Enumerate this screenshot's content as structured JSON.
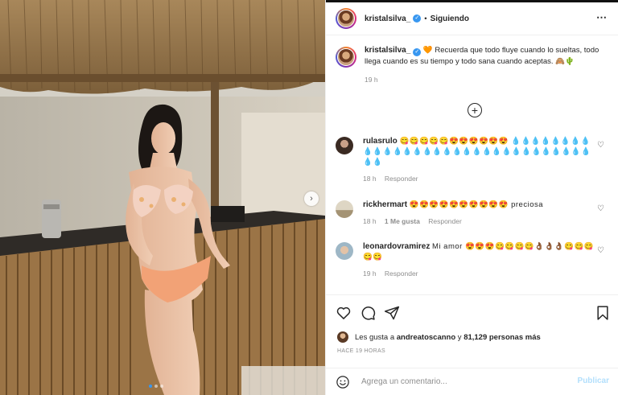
{
  "post": {
    "username": "kristalsilva_",
    "verified": true,
    "separator": "•",
    "follow_status": "Siguiendo",
    "more_icon": "⋯",
    "caption": {
      "text": "Recuerda que todo fluye cuando lo sueltas, todo llega cuando es su tiempo y todo sana cuando aceptas.",
      "prefix_emoji": "🧡",
      "suffix_emoji": "🙈🌵",
      "time": "19 h"
    },
    "load_more_icon": "+",
    "carousel": {
      "next_icon": "›",
      "slide_count": 3,
      "active_index": 0
    },
    "comments": [
      {
        "username": "rulasrulo",
        "text": "😋😋😋😋😋😍😍😍😍😍😍 💧💧💧💧💧💧💧💧💧💧💧💧💧💧💧💧💧💧💧💧💧💧💧💧💧💧💧💧💧💧💧💧💧",
        "time": "18 h",
        "likes": "",
        "reply": "Responder"
      },
      {
        "username": "rickhermart",
        "text": "😍😍😍😍😍😍😍😍😍😍 preciosa",
        "time": "18 h",
        "likes": "1 Me gusta",
        "reply": "Responder"
      },
      {
        "username": "leonardovramirez",
        "text": "Mi amor 😍😍😍😋😋😋😋👌🏾👌🏾👌🏾😋😋😋😋😋",
        "time": "19 h",
        "likes": "",
        "reply": "Responder"
      }
    ],
    "likes": {
      "prefix": "Les gusta a",
      "user": "andreatoscanno",
      "middle": "y",
      "count": "81,129 personas más"
    },
    "time_ago": "HACE 19 HORAS",
    "comment_input": {
      "placeholder": "Agrega un comentario...",
      "value": ""
    },
    "publish_label": "Publicar",
    "icons": {
      "like": "heart-icon",
      "comment": "comment-icon",
      "share": "share-icon",
      "save": "bookmark-icon",
      "emoji": "smile-icon"
    },
    "colors": {
      "verified": "#3897f0",
      "publish_disabled": "#b2dffc",
      "meta_text": "#8e8e8e"
    }
  }
}
